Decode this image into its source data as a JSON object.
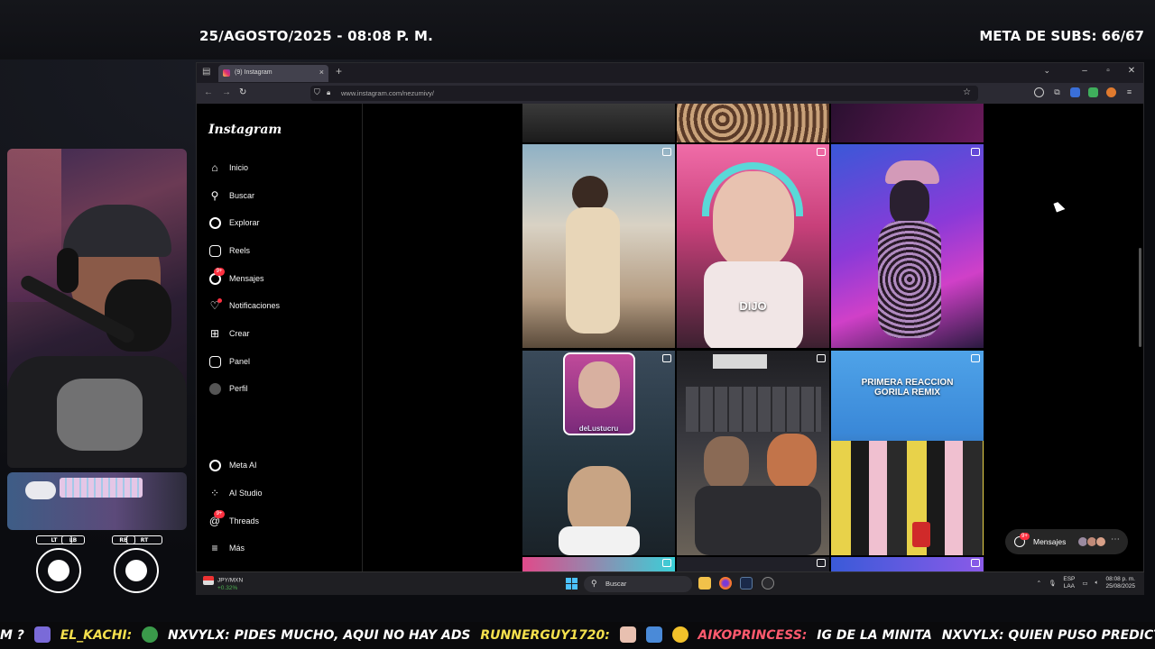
{
  "overlay": {
    "date": "25/AGOSTO/2025 - 08:08 P. M.",
    "subs": "META DE SUBS: 66/67"
  },
  "controller": {
    "lt": "LT",
    "lb": "LB",
    "rb": "RB",
    "rt": "RT"
  },
  "browser": {
    "tab_title": "(9) Instagram",
    "url": "www.instagram.com/nezumivy/"
  },
  "instagram": {
    "logo": "Instagram",
    "nav": [
      {
        "label": "Inicio",
        "icon": "home-icon"
      },
      {
        "label": "Buscar",
        "icon": "search-icon"
      },
      {
        "label": "Explorar",
        "icon": "compass-icon"
      },
      {
        "label": "Reels",
        "icon": "reels-icon"
      },
      {
        "label": "Mensajes",
        "icon": "messenger-icon",
        "badge": "9+"
      },
      {
        "label": "Notificaciones",
        "icon": "heart-icon"
      },
      {
        "label": "Crear",
        "icon": "plus-square-icon"
      },
      {
        "label": "Panel",
        "icon": "dashboard-icon"
      },
      {
        "label": "Perfil",
        "icon": "avatar-icon"
      }
    ],
    "nav_bottom": [
      {
        "label": "Meta AI",
        "icon": "meta-ai-icon"
      },
      {
        "label": "AI Studio",
        "icon": "ai-studio-icon"
      },
      {
        "label": "Threads",
        "icon": "threads-icon",
        "badge": "9+"
      },
      {
        "label": "Más",
        "icon": "menu-icon"
      }
    ],
    "posts": [
      {
        "caption": ""
      },
      {
        "caption": ""
      },
      {
        "caption": ""
      },
      {
        "caption": ""
      },
      {
        "caption": "DIJO"
      },
      {
        "caption": ""
      },
      {
        "caption": "deLustucru"
      },
      {
        "caption": ""
      },
      {
        "caption": "PRIMERA REACCION GORILA REMIX"
      }
    ],
    "messages_pill": {
      "label": "Mensajes",
      "badge": "9+"
    }
  },
  "taskbar": {
    "stock_symbol": "JPY/MXN",
    "stock_change": "+0.32%",
    "search_placeholder": "Buscar",
    "lang_top": "ESP",
    "lang_bottom": "LAA",
    "time": "08:08 p. m.",
    "date": "25/08/2025"
  },
  "ticker": [
    {
      "text": "M ?",
      "color": "#ffffff"
    },
    {
      "text": "EL_KACHI:",
      "color": "#f4e04d"
    },
    {
      "text": "NXVYLX: PIDES MUCHO, AQUI NO HAY ADS",
      "color": "#ffffff"
    },
    {
      "text": "RUNNERGUY1720:",
      "color": "#f4e04d"
    },
    {
      "text": "AIKOPRINCESS:",
      "color": "#ff5a6e"
    },
    {
      "text": "IG DE LA MINITA",
      "color": "#ffffff"
    },
    {
      "text": "NXVYLX: QUIEN PUSO PREDICT TONS",
      "color": "#ffffff"
    }
  ],
  "colors": {
    "accent_badge": "#ff3040",
    "firefox_tab": "#42414d",
    "windows_blue": "#4cc2ff"
  }
}
